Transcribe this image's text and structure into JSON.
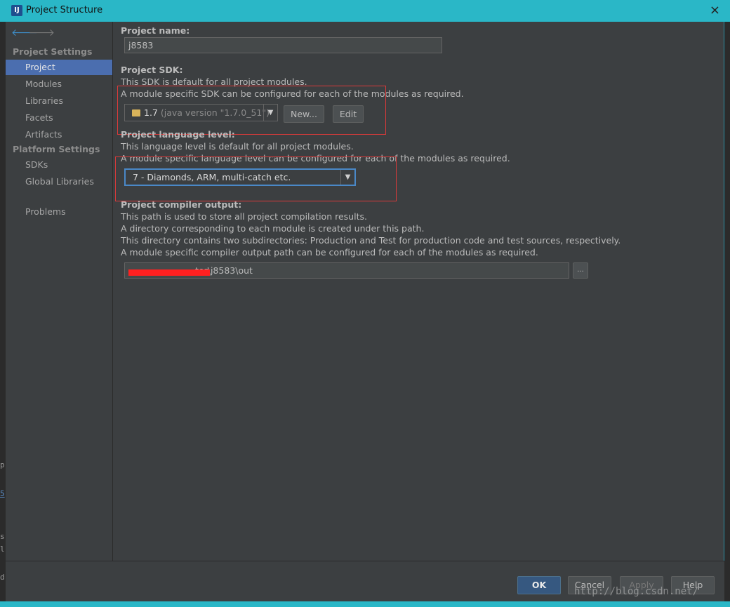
{
  "window": {
    "title": "Project Structure",
    "app_icon": "intellij-icon",
    "close_icon": "×"
  },
  "sidebar": {
    "back_icon": "🡐",
    "forward_icon": "🡒",
    "group_project_settings": "Project Settings",
    "group_platform_settings": "Platform Settings",
    "items": [
      {
        "label": "Project"
      },
      {
        "label": "Modules"
      },
      {
        "label": "Libraries"
      },
      {
        "label": "Facets"
      },
      {
        "label": "Artifacts"
      },
      {
        "label": "SDKs"
      },
      {
        "label": "Global Libraries"
      },
      {
        "label": "Problems"
      }
    ]
  },
  "main": {
    "project_name_label": "Project name:",
    "project_name_value": "j8583",
    "sdk_label": "Project SDK:",
    "sdk_desc1": "This SDK is default for all project modules.",
    "sdk_desc2": "A module specific SDK can be configured for each of the modules as required.",
    "sdk_selected_version": "1.7",
    "sdk_selected_detail": "(java version \"1.7.0_51\")",
    "sdk_new_button": "New...",
    "sdk_edit_button": "Edit",
    "lang_label": "Project language level:",
    "lang_desc1": "This language level is default for all project modules.",
    "lang_desc2": "A module specific language level can be configured for each of the modules as required.",
    "lang_selected": "7 - Diamonds, ARM, multi-catch etc.",
    "output_label": "Project compiler output:",
    "output_desc1": "This path is used to store all project compilation results.",
    "output_desc2": "A directory corresponding to each module is created under this path.",
    "output_desc3": "This directory contains two subdirectories: Production and Test for production code and test sources, respectively.",
    "output_desc4": "A module specific compiler output path can be configured for each of the modules as required.",
    "output_path": "ter\\j8583\\out",
    "browse_button": "..."
  },
  "footer": {
    "ok": "OK",
    "cancel": "Cancel",
    "apply": "Apply",
    "help": "Help"
  },
  "watermark": "http://blog.csdn.net/",
  "colors": {
    "selection": "#4b6eaf",
    "title_bar": "#2ab7c7",
    "highlight_box": "#d93a3a",
    "ok_button": "#365880"
  }
}
